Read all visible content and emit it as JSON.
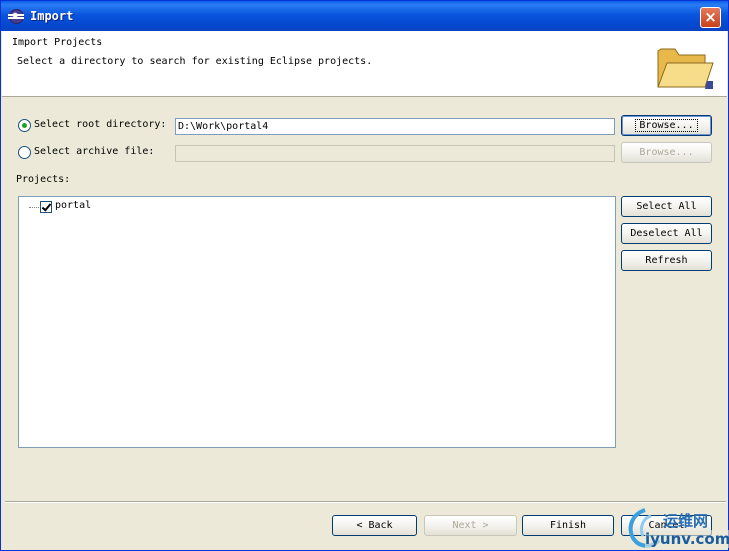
{
  "window": {
    "title": "Import",
    "close_label": "×"
  },
  "header": {
    "title": "Import Projects",
    "description": "Select a directory to search for existing Eclipse projects."
  },
  "root_dir": {
    "label": "Select root directory:",
    "selected": true,
    "value": "D:\\Work\\portal4",
    "browse_label": "Browse..."
  },
  "archive": {
    "label": "Select archive file:",
    "selected": false,
    "value": "",
    "browse_label": "Browse..."
  },
  "projects": {
    "label": "Projects:",
    "items": [
      {
        "name": "portal",
        "checked": true
      }
    ],
    "select_all_label": "Select All",
    "deselect_all_label": "Deselect All",
    "refresh_label": "Refresh"
  },
  "footer": {
    "back_label": "< Back",
    "next_label": "Next >",
    "finish_label": "Finish",
    "cancel_label": "Cancel"
  },
  "watermark": {
    "text_cn": "运维网",
    "text_url": "iyunv.com"
  },
  "colors": {
    "titlebar": "#0a56de",
    "dialog_bg": "#ece9d8",
    "radio_dot": "#21a121",
    "close_button": "#c8411c"
  }
}
